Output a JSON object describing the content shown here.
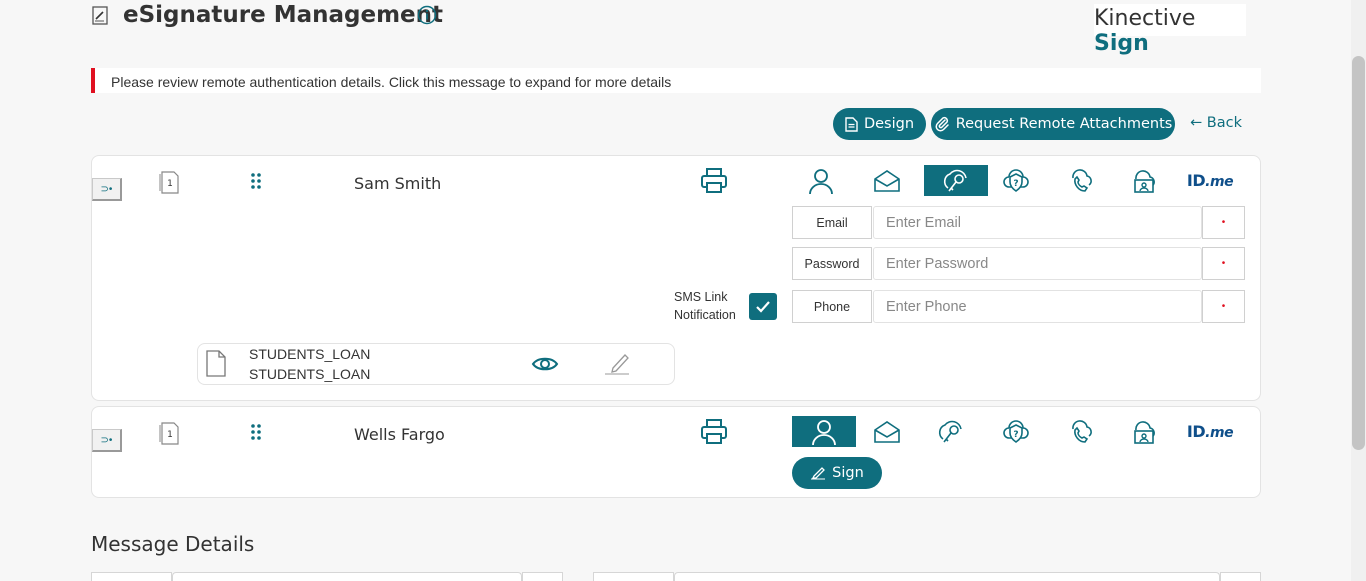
{
  "header": {
    "title": "eSignature Management",
    "brand_prefix": "Kinective",
    "brand_suffix": "Sign"
  },
  "alert": {
    "message": "Please review remote authentication details. Click this message to expand for more details"
  },
  "toolbar": {
    "design_label": "Design",
    "attachments_label": "Request Remote Attachments",
    "back_label": "← Back"
  },
  "signers": [
    {
      "name": "Sam Smith",
      "doc_badge": "1",
      "auth_tabs": [
        "person-icon",
        "envelope-icon",
        "key-icon",
        "shield-question-icon",
        "phone-icon",
        "id-card-icon",
        "idme-logo"
      ],
      "active_auth": "key-icon",
      "idme_prefix": "ID",
      "idme_suffix": ".me",
      "fields": [
        {
          "label": "Email",
          "placeholder": "Enter Email",
          "value": "",
          "required_mark": "•"
        },
        {
          "label": "Password",
          "placeholder": "Enter Password",
          "value": "",
          "required_mark": "•"
        },
        {
          "label": "Phone",
          "placeholder": "Enter Phone",
          "value": "",
          "required_mark": "•"
        }
      ],
      "sms_label_line1": "SMS Link",
      "sms_label_line2": "Notification",
      "sms_checked": true,
      "document": {
        "line1": "STUDENTS_LOAN",
        "line2": "STUDENTS_LOAN"
      }
    },
    {
      "name": "Wells Fargo",
      "doc_badge": "1",
      "active_auth": "person-icon",
      "idme_prefix": "ID",
      "idme_suffix": ".me",
      "sign_label": "Sign"
    }
  ],
  "message_section": {
    "title": "Message Details"
  },
  "colors": {
    "accent": "#0f6e7e",
    "alert_bar": "#e01020",
    "background": "#f7f7f7"
  }
}
